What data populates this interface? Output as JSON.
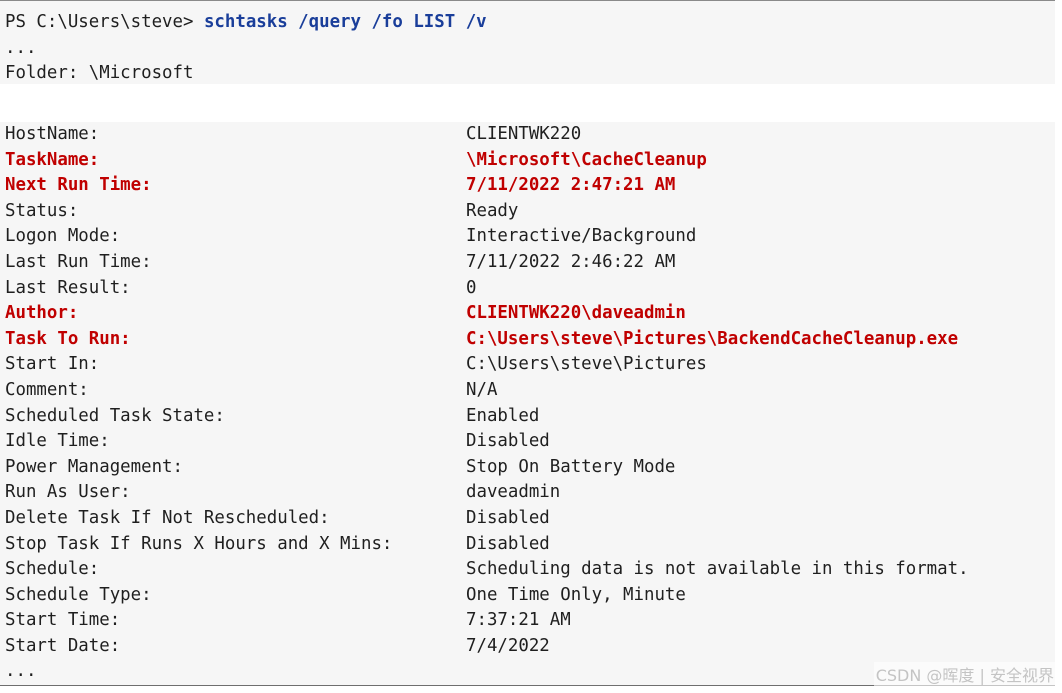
{
  "prompt": {
    "prefix": "PS C:\\Users\\steve> ",
    "command": "schtasks /query /fo LIST /v"
  },
  "header_lines": [
    "...",
    "Folder: \\Microsoft"
  ],
  "fields": [
    {
      "key": "HostName:",
      "value": "CLIENTWK220",
      "highlight": false
    },
    {
      "key": "TaskName:",
      "value": "\\Microsoft\\CacheCleanup",
      "highlight": true
    },
    {
      "key": "Next Run Time:",
      "value": "7/11/2022 2:47:21 AM",
      "highlight": true
    },
    {
      "key": "Status:",
      "value": "Ready",
      "highlight": false
    },
    {
      "key": "Logon Mode:",
      "value": "Interactive/Background",
      "highlight": false
    },
    {
      "key": "Last Run Time:",
      "value": "7/11/2022 2:46:22 AM",
      "highlight": false
    },
    {
      "key": "Last Result:",
      "value": "0",
      "highlight": false
    },
    {
      "key": "Author:",
      "value": "CLIENTWK220\\daveadmin",
      "highlight": true
    },
    {
      "key": "Task To Run:",
      "value": "C:\\Users\\steve\\Pictures\\BackendCacheCleanup.exe",
      "highlight": true
    },
    {
      "key": "Start In:",
      "value": "C:\\Users\\steve\\Pictures",
      "highlight": false
    },
    {
      "key": "Comment:",
      "value": "N/A",
      "highlight": false
    },
    {
      "key": "Scheduled Task State:",
      "value": "Enabled",
      "highlight": false
    },
    {
      "key": "Idle Time:",
      "value": "Disabled",
      "highlight": false
    },
    {
      "key": "Power Management:",
      "value": "Stop On Battery Mode",
      "highlight": false
    },
    {
      "key": "Run As User:",
      "value": "daveadmin",
      "highlight": false
    },
    {
      "key": "Delete Task If Not Rescheduled:",
      "value": "Disabled",
      "highlight": false
    },
    {
      "key": "Stop Task If Runs X Hours and X Mins:",
      "value": "Disabled",
      "highlight": false
    },
    {
      "key": "Schedule:",
      "value": "Scheduling data is not available in this format.",
      "highlight": false
    },
    {
      "key": "Schedule Type:",
      "value": "One Time Only, Minute",
      "highlight": false
    },
    {
      "key": "Start Time:",
      "value": "7:37:21 AM",
      "highlight": false
    },
    {
      "key": "Start Date:",
      "value": "7/4/2022",
      "highlight": false
    }
  ],
  "footer_line": "...",
  "watermark": "CSDN @晖度 | 安全视界",
  "colors": {
    "highlight": "#c00000",
    "command": "#1a3e9a",
    "background": "#f6f6f6"
  }
}
